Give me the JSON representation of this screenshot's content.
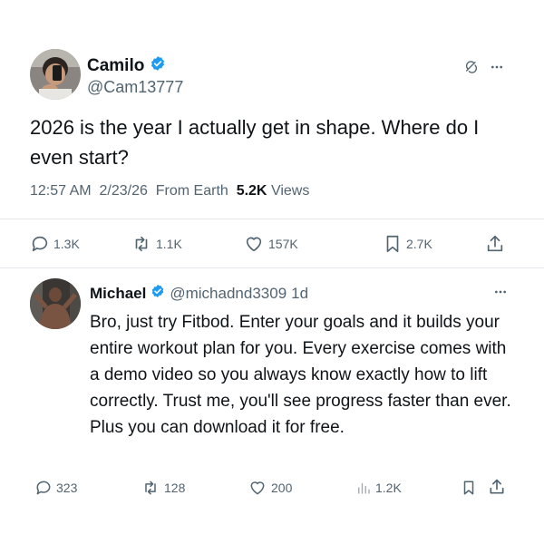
{
  "post": {
    "author": {
      "name": "Camilo",
      "handle": "@Cam13777",
      "verified": true
    },
    "text": "2026 is the year I actually get in shape. Where do I even start?",
    "time": "12:57 AM",
    "date": "2/23/26",
    "source": "From Earth",
    "views_count": "5.2K",
    "views_label": "Views",
    "stats": {
      "replies": "1.3K",
      "reposts": "1.1K",
      "likes": "157K",
      "bookmarks": "2.7K"
    }
  },
  "reply": {
    "author": {
      "name": "Michael",
      "handle": "@michadnd3309",
      "verified": true
    },
    "age": "1d",
    "text": "Bro, just try Fitbod. Enter your goals and it builds your entire workout plan for you. Every exercise comes with a demo video so you always know exactly how to lift correctly. Trust me, you'll see progress faster than ever. Plus you can download it for free.",
    "stats": {
      "replies": "323",
      "reposts": "128",
      "likes": "200",
      "views": "1.2K"
    }
  },
  "colors": {
    "verified": "#1d9bf0",
    "muted": "#536471",
    "text": "#0f1419"
  }
}
